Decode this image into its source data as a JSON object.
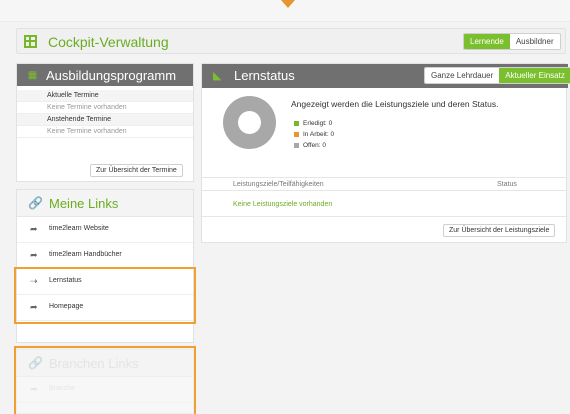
{
  "header": {
    "title": "Cockpit-Verwaltung",
    "toggle": [
      "Lernende",
      "Ausbildner"
    ],
    "active": "Lernende"
  },
  "ausbildung": {
    "title": "Ausbildungsprogramm",
    "rows": [
      {
        "text": "Aktuelle Termine",
        "kind": "header"
      },
      {
        "text": "Keine Termine vorhanden",
        "kind": "muted"
      },
      {
        "text": "Anstehende Termine",
        "kind": "header"
      },
      {
        "text": "Keine Termine vorhanden",
        "kind": "muted"
      }
    ],
    "button": "Zur Übersicht der Termine"
  },
  "links": {
    "title": "Meine Links",
    "items": [
      {
        "label": "time2learn Website",
        "icon": "share-arrow-icon"
      },
      {
        "label": "time2learn Handbücher",
        "icon": "share-arrow-icon"
      },
      {
        "label": "Lernstatus",
        "icon": "chart-icon"
      },
      {
        "label": "Homepage",
        "icon": "share-arrow-icon"
      }
    ]
  },
  "branchen": {
    "title": "Branchen Links",
    "items": [
      {
        "label": "Branche"
      }
    ]
  },
  "lernstatus": {
    "title": "Lernstatus",
    "toggle": [
      "Ganze Lehrdauer",
      "Aktueller Einsatz"
    ],
    "active": "Aktueller Einsatz",
    "description": "Angezeigt werden die Leistungsziele und deren Status.",
    "legend": [
      {
        "label": "Erledigt:",
        "value": "0",
        "color": "#76b82a"
      },
      {
        "label": "In Arbeit:",
        "value": "0",
        "color": "#e8952f"
      },
      {
        "label": "Offen:",
        "value": "0",
        "color": "#a8a8a8"
      }
    ],
    "columns": [
      "Leistungsziele/Teilfähigkeiten",
      "Status"
    ],
    "empty": "Keine Leistungsziele vorhanden",
    "button": "Zur Übersicht der Leistungsziele"
  },
  "colors": {
    "accent": "#76b82a",
    "highlight": "#f0a030",
    "header_grey": "#707070"
  }
}
